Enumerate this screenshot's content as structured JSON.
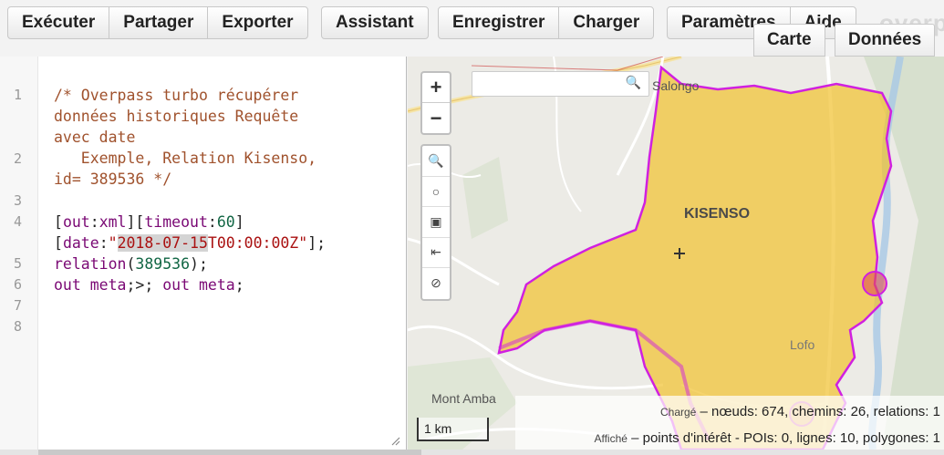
{
  "toolbar": {
    "run": "Exécuter",
    "share": "Partager",
    "export": "Exporter",
    "wizard": "Assistant",
    "save": "Enregistrer",
    "load": "Charger",
    "settings": "Paramètres",
    "help": "Aide",
    "logo": "overp"
  },
  "tabs": {
    "map": "Carte",
    "data": "Données"
  },
  "editor": {
    "line_numbers": [
      "1",
      "2",
      "3",
      "4",
      "5",
      "6",
      "7",
      "8"
    ],
    "comment_1": "/* Overpass turbo récupérer",
    "comment_2": "données historiques Requête",
    "comment_3": "avec date",
    "comment_4": "   Exemple, Relation Kisenso,",
    "comment_5": "id= 389536 */",
    "l4_open": "[",
    "l4_out": "out",
    "l4_colon1": ":",
    "l4_xml": "xml",
    "l4_mid": "][",
    "l4_timeout": "timeout",
    "l4_colon2": ":",
    "l4_60": "60",
    "l4_close": "]",
    "l4b_open": "[",
    "l4b_date": "date",
    "l4b_colon": ":",
    "l4b_q1": "\"",
    "l4b_datehl": "2018-07-15",
    "l4b_rest": "T00:00:00Z\"",
    "l4b_end": "];",
    "l5_rel": "relation",
    "l5_p1": "(",
    "l5_id": "389536",
    "l5_p2": ");",
    "l6_out1": "out meta",
    "l6_mid": ";>; ",
    "l6_out2": "out meta",
    "l6_end": ";"
  },
  "map": {
    "search_placeholder": "",
    "zoom_in": "+",
    "zoom_out": "−",
    "labels": {
      "salongo": "Salongo",
      "kisenso": "KISENSO",
      "lofo": "Lofo",
      "mont_amba": "Mont Amba"
    },
    "scale": "1 km",
    "stats": {
      "loaded_label": "Chargé",
      "loaded_text": " – nœuds: 674, chemins: 26, relations: 1",
      "shown_label": "Affiché",
      "shown_text": " – points d'intérêt - POIs: 0, lignes: 10, polygones: 1"
    }
  },
  "colors": {
    "polygon_fill": "#f1c232",
    "polygon_stroke": "#d020e0",
    "poi": "#e05050"
  }
}
